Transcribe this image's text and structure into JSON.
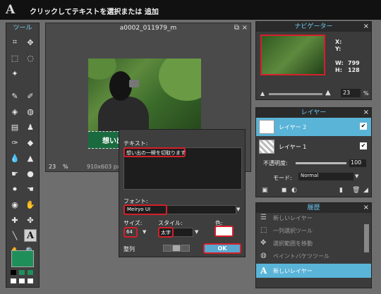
{
  "topbar": {
    "logo": "A",
    "hint": "クリックしてテキストを選択または 追加"
  },
  "tools": {
    "title": "ツール",
    "selected_tool": "A"
  },
  "document": {
    "title": "a0002_011979_m",
    "zoom": "23",
    "zoom_unit": "%",
    "size": "910x603 px",
    "overlay_text": "想い出の一瞬を切取ります"
  },
  "dialog": {
    "text_label": "テキスト:",
    "text_value": "想い出の一瞬を切取ります",
    "font_label": "フォント:",
    "font_value": "Meiryo UI",
    "size_label": "サイズ:",
    "size_value": "64",
    "style_label": "スタイル:",
    "style_value": "太字",
    "color_label": "色:",
    "color_value": "#ffffff",
    "align_label": "整列",
    "ok_label": "OK"
  },
  "navigator": {
    "title": "ナビゲーター",
    "x_label": "X:",
    "y_label": "Y:",
    "w_label": "W:",
    "w_value": "799",
    "h_label": "H:",
    "h_value": "128",
    "zoom_value": "23",
    "zoom_unit": "%"
  },
  "layers": {
    "title": "レイヤー",
    "items": [
      {
        "label": "レイヤー 2",
        "checked": true
      },
      {
        "label": "レイヤー 1",
        "checked": true
      }
    ],
    "opacity_label": "不透明度:",
    "opacity_value": "100",
    "mode_label": "モード:",
    "mode_value": "Normal"
  },
  "history": {
    "title": "履歴",
    "items": [
      {
        "label": "新しいレイヤー"
      },
      {
        "label": "一列選択ツール"
      },
      {
        "label": "選択範囲を移動"
      },
      {
        "label": "ペイントバケツツール"
      },
      {
        "label": "新しいレイヤー"
      }
    ]
  }
}
